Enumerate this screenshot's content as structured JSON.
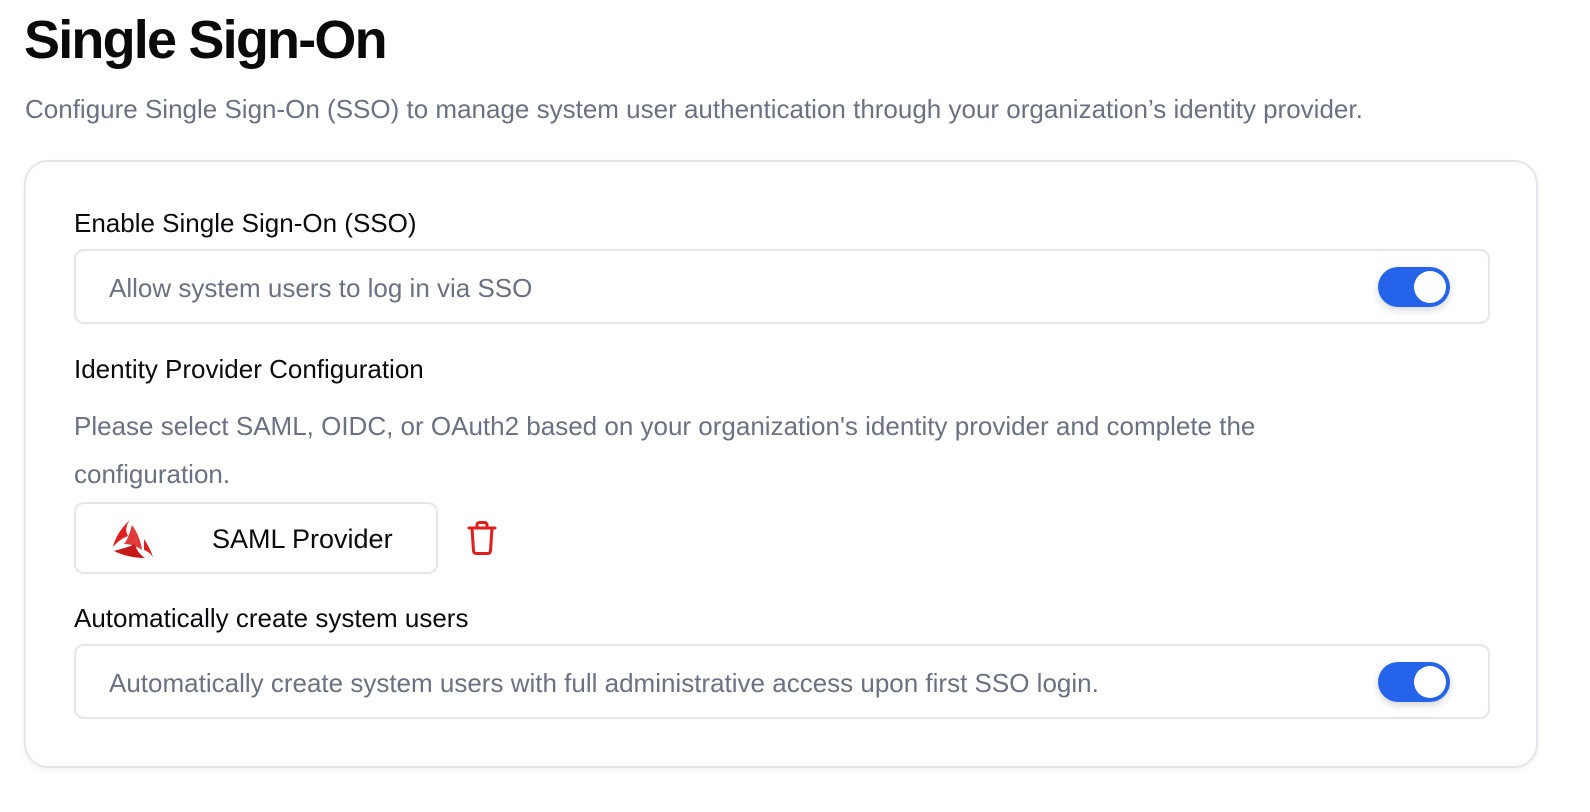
{
  "page": {
    "title": "Single Sign-On",
    "description": "Configure Single Sign-On (SSO) to manage system user authentication through your organization’s identity provider."
  },
  "sso_enable": {
    "label": "Enable Single Sign-On (SSO)",
    "text": "Allow system users to log in via SSO",
    "enabled": true
  },
  "idp": {
    "label": "Identity Provider Configuration",
    "description": "Please select SAML, OIDC, or OAuth2 based on your organization's identity provider and complete the configuration.",
    "provider": {
      "name": "SAML Provider",
      "logo_icon": "saml-logo-icon",
      "delete_icon": "trash-icon"
    }
  },
  "auto_create": {
    "label": "Automatically create system users",
    "text": "Automatically create system users with full administrative access upon first SSO login.",
    "enabled": true
  },
  "colors": {
    "toggle_on": "#2563eb",
    "delete": "#e11d1d",
    "logo": "#e02020",
    "muted_text": "#6b7180",
    "border": "#e4e6ea"
  }
}
